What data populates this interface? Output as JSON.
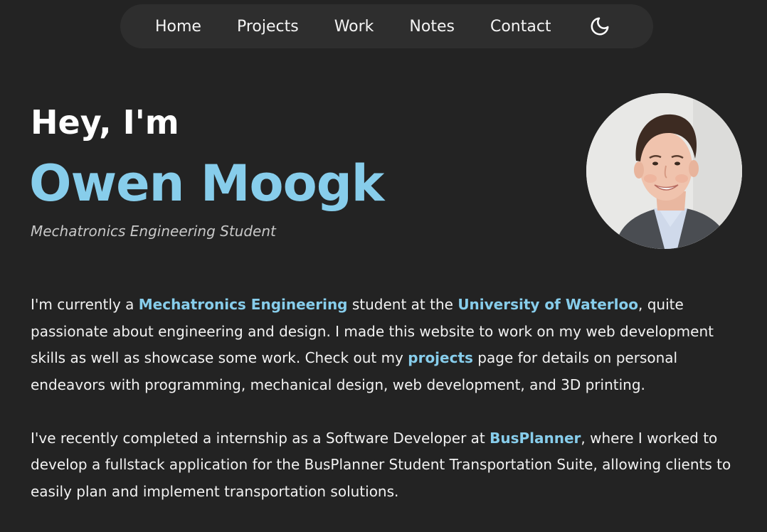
{
  "nav": {
    "items": [
      {
        "label": "Home"
      },
      {
        "label": "Projects"
      },
      {
        "label": "Work"
      },
      {
        "label": "Notes"
      },
      {
        "label": "Contact"
      }
    ],
    "theme_toggle_icon": "moon-icon"
  },
  "hero": {
    "greeting": "Hey, I'm",
    "name": "Owen Moogk",
    "subtitle": "Mechatronics Engineering Student"
  },
  "bio": {
    "p1": {
      "t1": "I'm currently a ",
      "link1": "Mechatronics Engineering",
      "t2": " student at the ",
      "link2": "University of Waterloo",
      "t3": ", quite passionate about engineering and design. I made this website to work on my web development skills as well as showcase some work. Check out my ",
      "link3": "projects",
      "t4": " page for details on personal endeavors with programming, mechanical design, web development, and 3D printing."
    },
    "p2": {
      "t1": "I've recently completed a internship as a Software Developer at ",
      "link1": "BusPlanner",
      "t2": ", where I worked to develop a fullstack application for the BusPlanner Student Transportation Suite, allowing clients to easily plan and implement transportation solutions."
    }
  },
  "colors": {
    "background": "#232323",
    "nav_background": "#2e2e2e",
    "accent": "#87cdeb",
    "text": "#f2f2f2"
  }
}
